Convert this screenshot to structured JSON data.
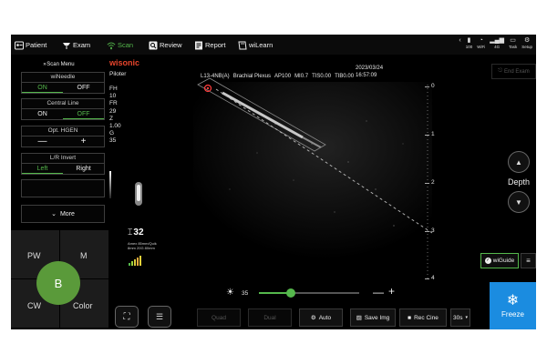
{
  "topbar": {
    "nav": [
      {
        "label": "Patient",
        "icon": "patient-icon"
      },
      {
        "label": "Exam",
        "icon": "probe-icon"
      },
      {
        "label": "Scan",
        "icon": "wifi-scan-icon",
        "active": true
      },
      {
        "label": "Review",
        "icon": "review-icon"
      },
      {
        "label": "Report",
        "icon": "report-icon"
      },
      {
        "label": "wiLearn",
        "icon": "book-icon"
      }
    ],
    "sys": [
      {
        "glyph": "‹",
        "label": ""
      },
      {
        "glyph": "▮",
        "label": "100"
      },
      {
        "glyph": "◔",
        "label": "WiFi"
      },
      {
        "glyph": "▂▄▆",
        "label": "4G"
      },
      {
        "glyph": "▭",
        "label": "Task"
      },
      {
        "glyph": "⚙",
        "label": "Setup"
      }
    ]
  },
  "left_menu": {
    "title": "Scan Menu",
    "wineedle": {
      "label": "wiNeedle",
      "on": "ON",
      "off": "OFF"
    },
    "central_line": {
      "label": "Central Line",
      "on": "ON",
      "off": "OFF"
    },
    "opt_hgen": {
      "label": "Opt. HGEN",
      "minus": "—",
      "plus": "+"
    },
    "lr_invert": {
      "label": "L/R Invert",
      "left": "Left",
      "right": "Right"
    },
    "more": "More"
  },
  "modes": {
    "pw": "PW",
    "m": "M",
    "cw": "CW",
    "color": "Color",
    "b": "B"
  },
  "brand": {
    "name": "wisonic",
    "sub": "Piloter"
  },
  "params": [
    {
      "k": "FH",
      "v": "10"
    },
    {
      "k": "FR",
      "v": "29"
    },
    {
      "k": "Z",
      "v": "1.00"
    },
    {
      "k": "G",
      "v": "35"
    }
  ],
  "header": {
    "probe": "L13-4NB(A)",
    "preset": "Brachial Plexus",
    "ap": "AP100",
    "mi": "MI0.7",
    "tis": "TIS0.00",
    "tib": "TIB0.00",
    "date": "2023/03/24",
    "time": "16:57:09"
  },
  "needle": {
    "angle": "32",
    "info1": "Amex 85mm/Quik",
    "info2": "8mm 20G 80mm"
  },
  "depth_scale": [
    "0",
    "1",
    "2",
    "3",
    "4"
  ],
  "depth": {
    "label": "Depth",
    "up": "▲",
    "down": "▼"
  },
  "end_exam": "End Exam",
  "wiguide": "wiGuide",
  "brightness": {
    "value": "35",
    "level": 0.32,
    "minus": "—",
    "plus": "+"
  },
  "bottom": {
    "quad": "Quad",
    "dual": "Dual",
    "auto": "Auto",
    "save_img": "Save Img",
    "rec_cine": "Rec Cine",
    "cine_len": "30s"
  },
  "freeze": "Freeze",
  "colors": {
    "accent": "#55b84c",
    "freeze": "#1b8ce0",
    "brand": "#e8452c",
    "mode_b": "#5a9a3a"
  }
}
